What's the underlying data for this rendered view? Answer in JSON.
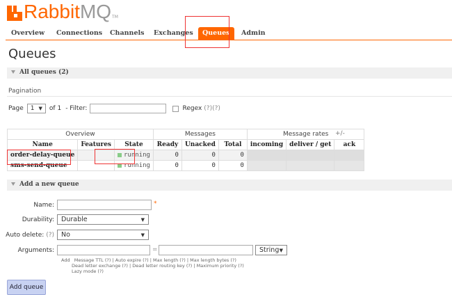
{
  "logo": {
    "brand_a": "Rabbit",
    "brand_b": "MQ",
    "tm": "TM"
  },
  "nav": {
    "tabs": [
      {
        "label": "Overview"
      },
      {
        "label": "Connections"
      },
      {
        "label": "Channels"
      },
      {
        "label": "Exchanges"
      },
      {
        "label": "Queues"
      },
      {
        "label": "Admin"
      }
    ],
    "active": "Queues"
  },
  "page_title": "Queues",
  "all_queues": {
    "label": "All queues (2)"
  },
  "pagination": {
    "label": "Pagination",
    "page_label": "Page",
    "page_value": "1",
    "of_label": "of 1",
    "filter_label": "- Filter:",
    "filter_value": "",
    "regex_label": "Regex",
    "regex_help": "(?)(?)"
  },
  "table": {
    "groups": [
      "Overview",
      "Messages",
      "Message rates"
    ],
    "plus_minus": "+/-",
    "headers": [
      "Name",
      "Features",
      "State",
      "Ready",
      "Unacked",
      "Total",
      "incoming",
      "deliver / get",
      "ack"
    ],
    "rows": [
      {
        "name": "order-delay-queue",
        "features": "",
        "state": "running",
        "ready": "0",
        "unacked": "0",
        "total": "0",
        "incoming": "",
        "deliver": "",
        "ack": ""
      },
      {
        "name": "sms-send-queue",
        "features": "",
        "state": "running",
        "ready": "0",
        "unacked": "0",
        "total": "0",
        "incoming": "",
        "deliver": "",
        "ack": ""
      }
    ]
  },
  "add_queue": {
    "section_label": "Add a new queue",
    "name_label": "Name:",
    "name_value": "",
    "required_mark": "*",
    "durability_label": "Durability:",
    "durability_value": "Durable",
    "auto_delete_label": "Auto delete:",
    "auto_delete_help": "(?)",
    "auto_delete_value": "No",
    "arguments_label": "Arguments:",
    "equals": "=",
    "type_value": "String",
    "help_add": "Add",
    "help_line1": "Message TTL (?) | Auto expire (?) | Max length (?) | Max length bytes (?)",
    "help_line2": "Dead letter exchange (?) | Dead letter routing key (?) | Maximum priority (?)",
    "help_line3": "Lazy mode (?)",
    "button_label": "Add queue"
  },
  "colors": {
    "accent": "#ff6600",
    "highlight": "#ee3333",
    "running": "#88cc88"
  }
}
